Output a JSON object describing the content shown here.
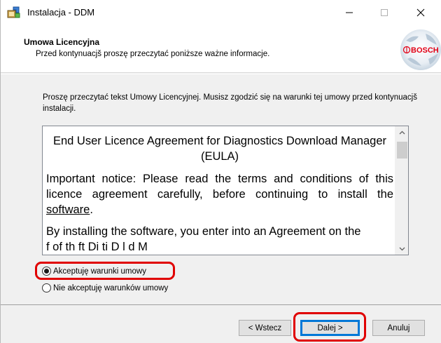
{
  "window": {
    "title": "Instalacja - DDM",
    "minimize_label": "—",
    "maximize_label": "☐",
    "close_label": "✕"
  },
  "header": {
    "title": "Umowa Licencyjna",
    "subtitle": "Przed kontynuacjš proszę przeczytać poniższe ważne informacje.",
    "logo_text": "BOSCH"
  },
  "intro": "Proszę przeczytać tekst Umowy Licencyjnej. Musisz zgodzić się na warunki tej umowy przed kontynuacjš instalacji.",
  "eula": {
    "title": "End User Licence Agreement for Diagnostics Download Manager (EULA)",
    "notice_before": "Important notice: Please read the terms and conditions of this licence agreement carefully, before continuing to install the ",
    "notice_link": "software",
    "notice_after": ".",
    "para2": "By installing the software, you enter into an Agreement on the",
    "para3": "f    of th   ft   Di    ti   D   l   d M"
  },
  "radios": {
    "accept_label": "Akceptuję warunki umowy",
    "reject_label": "Nie akceptuję warunków umowy",
    "selected": "accept"
  },
  "buttons": {
    "back": "< Wstecz",
    "next": "Dalej >",
    "cancel": "Anuluj"
  },
  "colors": {
    "highlight": "#e00000",
    "default_button_border": "#0078d7",
    "logo_red": "#e20015"
  }
}
